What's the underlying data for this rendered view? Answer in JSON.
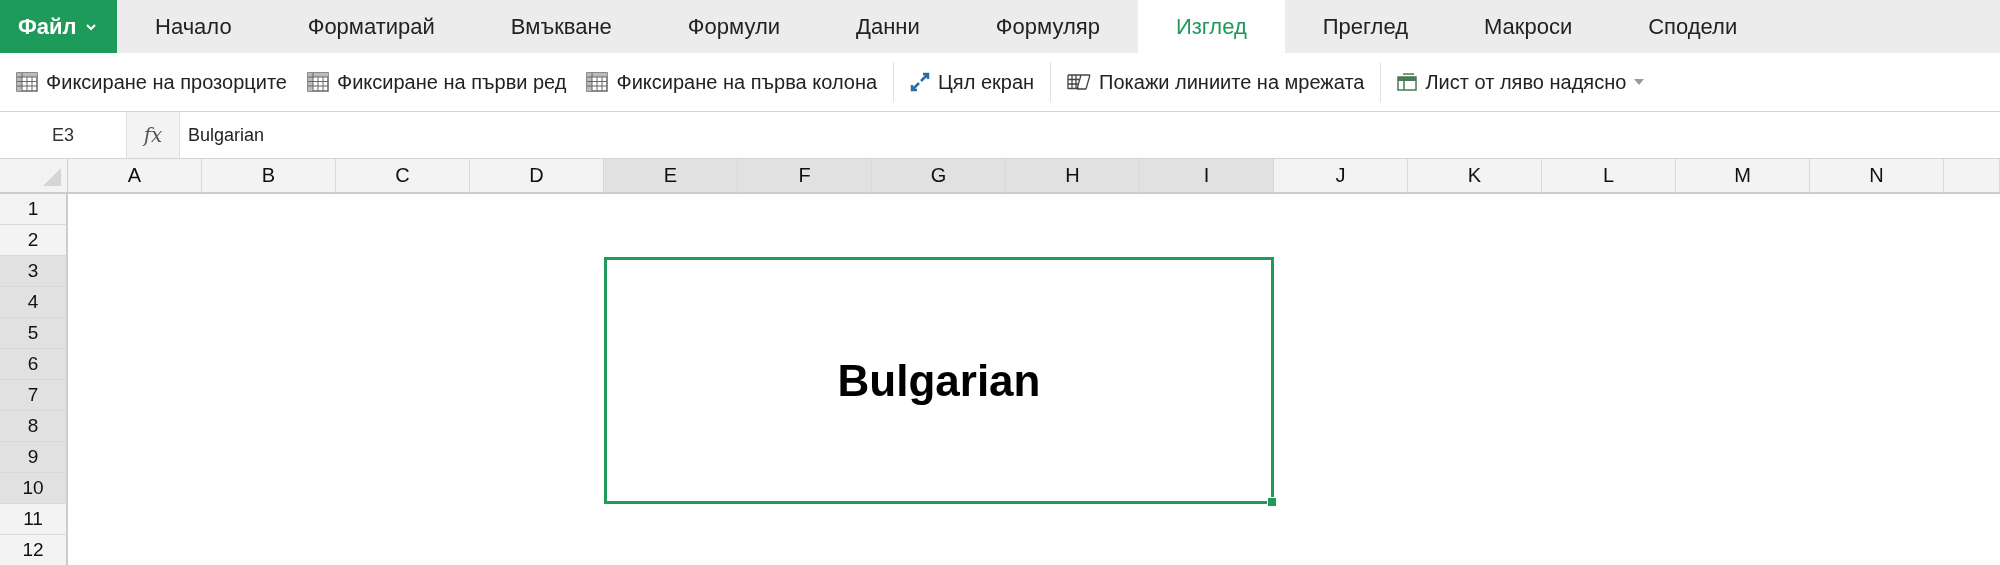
{
  "menu": {
    "file_tab": {
      "label": "Файл",
      "caret": true
    },
    "tabs": [
      {
        "label": "Начало",
        "selected": false
      },
      {
        "label": "Форматирай",
        "selected": false
      },
      {
        "label": "Вмъкване",
        "selected": false
      },
      {
        "label": "Формули",
        "selected": false
      },
      {
        "label": "Данни",
        "selected": false
      },
      {
        "label": "Формуляр",
        "selected": false
      },
      {
        "label": "Изглед",
        "selected": true
      },
      {
        "label": "Преглед",
        "selected": false
      },
      {
        "label": "Макроси",
        "selected": false
      },
      {
        "label": "Сподели",
        "selected": false
      }
    ]
  },
  "toolbar": {
    "groups": [
      [
        {
          "kind": "table",
          "label": "Фиксиране на прозорците",
          "dropdown": false
        },
        {
          "kind": "table",
          "label": "Фиксиране на първи ред",
          "dropdown": false
        },
        {
          "kind": "table",
          "label": "Фиксиране на първа колона",
          "dropdown": false
        }
      ],
      [
        {
          "kind": "expand",
          "label": "Цял екран",
          "dropdown": false
        }
      ],
      [
        {
          "kind": "gridlines",
          "label": "Покажи линиите на мрежата",
          "dropdown": false
        }
      ],
      [
        {
          "kind": "direction",
          "label": "Лист от ляво надясно",
          "dropdown": true
        }
      ]
    ]
  },
  "formula_bar": {
    "cell_ref": "E3",
    "fx": "fx",
    "value": "Bulgarian"
  },
  "sheet": {
    "columns": [
      {
        "label": "A",
        "selected": false
      },
      {
        "label": "B",
        "selected": false
      },
      {
        "label": "C",
        "selected": false
      },
      {
        "label": "D",
        "selected": false
      },
      {
        "label": "E",
        "selected": true
      },
      {
        "label": "F",
        "selected": true
      },
      {
        "label": "G",
        "selected": true
      },
      {
        "label": "H",
        "selected": true
      },
      {
        "label": "I",
        "selected": true
      },
      {
        "label": "J",
        "selected": false
      },
      {
        "label": "K",
        "selected": false
      },
      {
        "label": "L",
        "selected": false
      },
      {
        "label": "M",
        "selected": false
      },
      {
        "label": "N",
        "selected": false
      }
    ],
    "rows": [
      {
        "label": "1",
        "selected": false
      },
      {
        "label": "2",
        "selected": false
      },
      {
        "label": "3",
        "selected": true
      },
      {
        "label": "4",
        "selected": true
      },
      {
        "label": "5",
        "selected": true
      },
      {
        "label": "6",
        "selected": true
      },
      {
        "label": "7",
        "selected": true
      },
      {
        "label": "8",
        "selected": true
      },
      {
        "label": "9",
        "selected": true
      },
      {
        "label": "10",
        "selected": true
      },
      {
        "label": "11",
        "selected": false
      },
      {
        "label": "12",
        "selected": false
      }
    ],
    "merged_cell": {
      "value": "Bulgarian"
    }
  }
}
